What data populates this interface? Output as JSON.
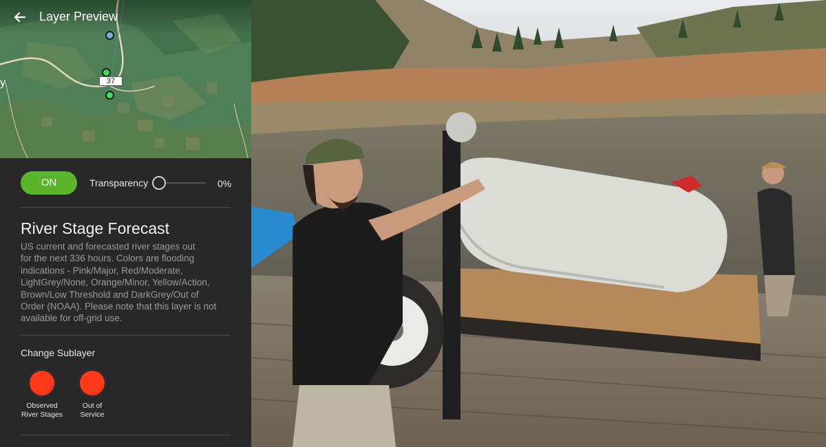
{
  "header": {
    "title": "Layer Preview",
    "back_icon": "arrow-left-icon"
  },
  "map": {
    "road_number": "37",
    "edge_label": "y"
  },
  "controls": {
    "toggle_label": "ON",
    "transparency_label": "Transparency",
    "transparency_value": "0%",
    "transparency_fraction": 0
  },
  "layer": {
    "title": "River Stage Forecast",
    "description": "US current and forecasted river stages out\nfor the next 336 hours. Colors are flooding\nindications - Pink/Major, Red/Moderate,\nLightGrey/None, Orange/Minor, Yellow/Action,\nBrown/Low Threshold and DarkGrey/Out of\nOrder (NOAA).  Please note that this layer is not\navailable for off-grid use."
  },
  "sublayers": {
    "title": "Change Sublayer",
    "items": [
      {
        "label": "Observed\nRiver Stages",
        "color": "#ff3b1c"
      },
      {
        "label": "Out of\nService",
        "color": "#ff3b1c"
      }
    ]
  },
  "colors": {
    "accent_green": "#5bb52a",
    "panel_bg": "#282828",
    "sublayer_red": "#ff3b1c",
    "marker_blue": "#7fa9ea",
    "marker_green": "#3be05a"
  }
}
